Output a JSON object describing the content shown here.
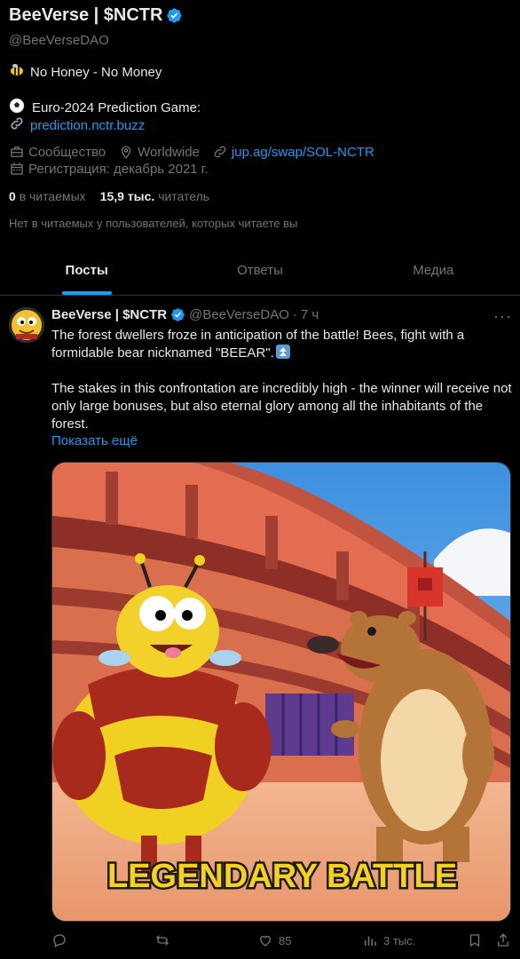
{
  "profile": {
    "name": "BeeVerse | $NCTR",
    "handle": "@BeeVerseDAO",
    "bio_line1": "No Honey - No Money",
    "bio_line2": "Euro-2024 Prediction Game:",
    "bio_link": "prediction.nctr.buzz",
    "category": "Сообщество",
    "location": "Worldwide",
    "website": "jup.ag/swap/SOL-NCTR",
    "joined": "Регистрация: декабрь 2021 г.",
    "following_count": "0",
    "following_label": "в читаемых",
    "followers_count": "15,9 тыс.",
    "followers_label": "читатель",
    "no_common_followers": "Нет в читаемых у пользователей, которых читаете вы"
  },
  "tabs": [
    {
      "label": "Посты",
      "active": true
    },
    {
      "label": "Ответы",
      "active": false
    },
    {
      "label": "Медиа",
      "active": false
    }
  ],
  "tweet": {
    "author_name": "BeeVerse | $NCTR",
    "author_handle": "@BeeVerseDAO",
    "separator": "·",
    "time": "7 ч",
    "more_label": "···",
    "text_p1": "The forest dwellers froze in anticipation of the battle! Bees, fight with a formidable bear nicknamed \"BEEAR\".",
    "text_p2": "The stakes in this confrontation are incredibly high - the winner will receive not only large bonuses, but also eternal glory among all the inhabitants of the forest.",
    "show_more": "Показать ещё",
    "image_caption": "LEGENDARY BATTLE",
    "likes": "85",
    "views": "3 тыс."
  },
  "colors": {
    "accent": "#1d9bf0",
    "secondary_text": "#71767b",
    "border": "#2f3336"
  }
}
